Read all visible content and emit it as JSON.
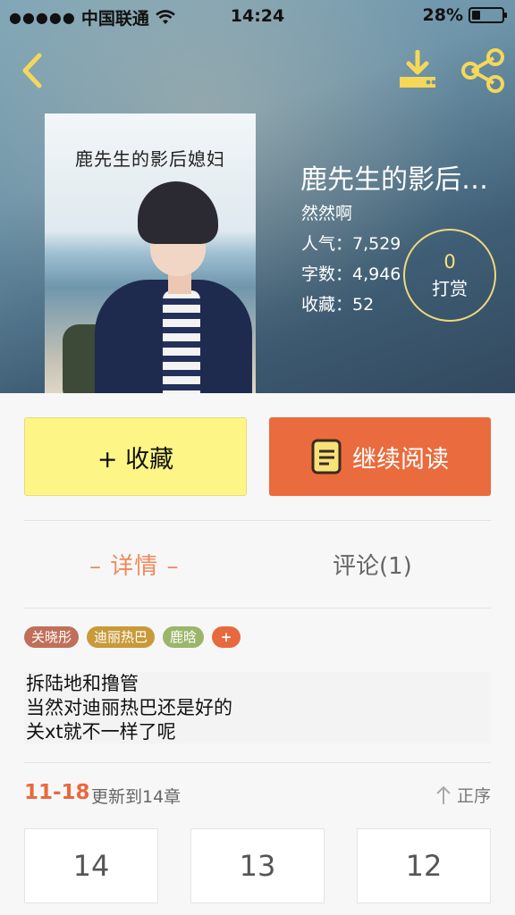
{
  "status_bar": {
    "signal_dots": "●●●●●",
    "carrier": "中国联通",
    "time": "14:24",
    "battery_percent": "28%",
    "battery_level": 0.28
  },
  "nav": {
    "back_icon": "chevron-left-icon",
    "download_icon": "download-icon",
    "share_icon": "share-icon",
    "icon_color": "#f5d75a"
  },
  "book": {
    "cover_title": "鹿先生的影后媳妇",
    "title": "鹿先生的影后…",
    "author": "然然啊",
    "popularity": "人气：7,529",
    "word_count": "字数：4,946",
    "favorites": "收藏：52",
    "tip_count": "0",
    "tip_label": "打赏"
  },
  "actions": {
    "favorite_label": "+ 收藏",
    "continue_label": "继续阅读"
  },
  "tabs": {
    "detail": "– 详情 –",
    "comments": "评论(1)"
  },
  "tags": [
    {
      "label": "关晓彤",
      "color": "#c0705a"
    },
    {
      "label": "迪丽热巴",
      "color": "#c99a3a"
    },
    {
      "label": "鹿晗",
      "color": "#9bb66a"
    },
    {
      "label": "+",
      "color": "#e8693d"
    }
  ],
  "description": [
    "拆陆地和撸管",
    "当然对迪丽热巴还是好的",
    "关xt就不一样了呢"
  ],
  "update": {
    "date": "11-18",
    "text": "更新到14章",
    "sort_label": "正序"
  },
  "chapters": [
    "14",
    "13",
    "12"
  ],
  "colors": {
    "accent_orange": "#ea6b3d",
    "favorite_yellow": "#fdf585"
  }
}
